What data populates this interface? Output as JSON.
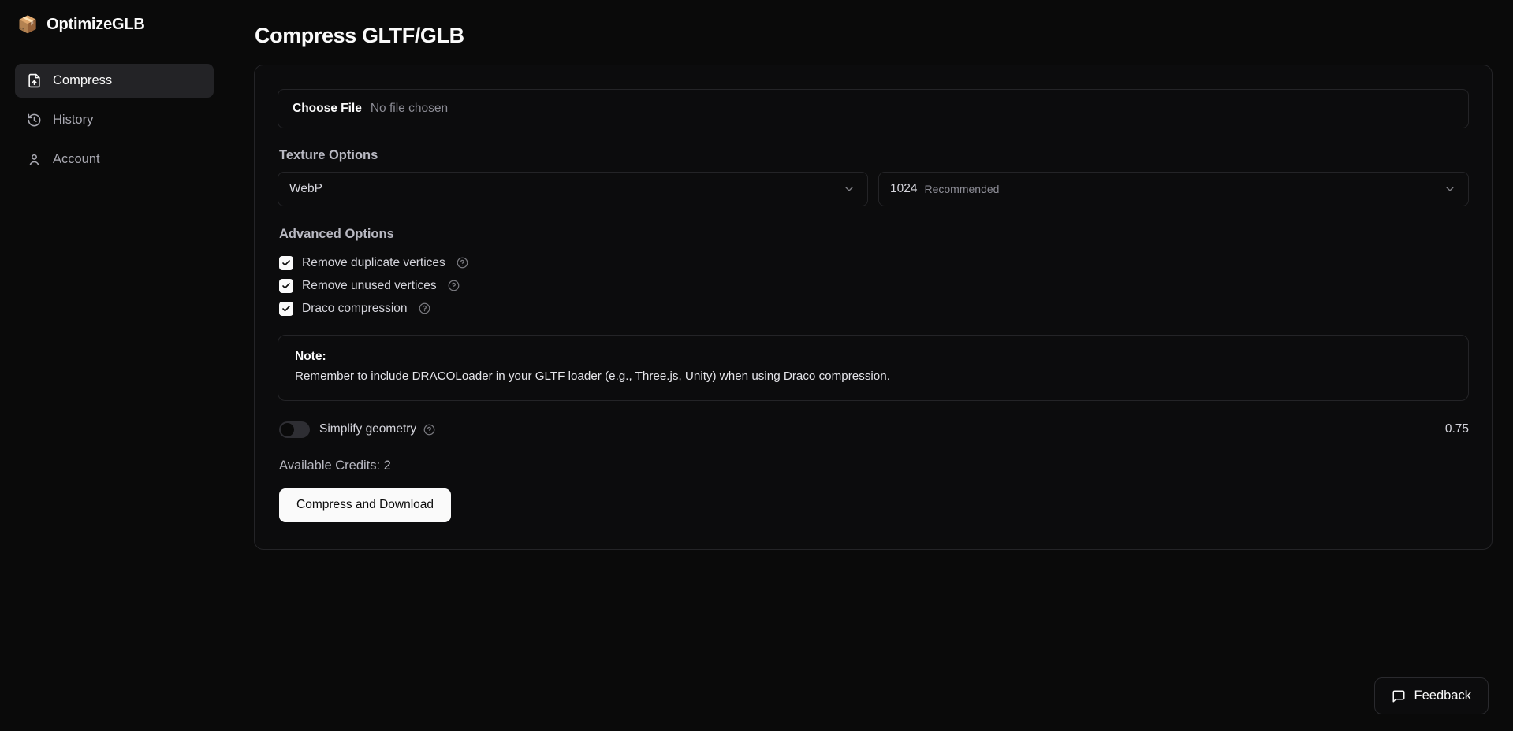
{
  "brand": {
    "icon": "package-icon",
    "glyph": "📦",
    "name": "OptimizeGLB"
  },
  "sidebar": {
    "items": [
      {
        "label": "Compress",
        "icon": "file-up-icon",
        "active": true
      },
      {
        "label": "History",
        "icon": "history-icon",
        "active": false
      },
      {
        "label": "Account",
        "icon": "user-icon",
        "active": false
      }
    ]
  },
  "page": {
    "title": "Compress GLTF/GLB"
  },
  "file_input": {
    "button_label": "Choose File",
    "status": "No file chosen"
  },
  "texture_options": {
    "heading": "Texture Options",
    "format_select": {
      "value": "WebP",
      "icon": "chevron-down-icon"
    },
    "resolution_select": {
      "value": "1024",
      "hint": "Recommended",
      "icon": "chevron-down-icon"
    }
  },
  "advanced_options": {
    "heading": "Advanced Options",
    "checkboxes": [
      {
        "label": "Remove duplicate vertices",
        "checked": true,
        "help_icon": "help-circle-icon"
      },
      {
        "label": "Remove unused vertices",
        "checked": true,
        "help_icon": "help-circle-icon"
      },
      {
        "label": "Draco compression",
        "checked": true,
        "help_icon": "help-circle-icon"
      }
    ]
  },
  "note": {
    "title": "Note:",
    "body": "Remember to include DRACOLoader in your GLTF loader (e.g., Three.js, Unity) when using Draco compression."
  },
  "simplify": {
    "label": "Simplify geometry",
    "enabled": false,
    "value": "0.75",
    "help_icon": "help-circle-icon"
  },
  "credits": {
    "text": "Available Credits: 2"
  },
  "actions": {
    "compress_label": "Compress and Download"
  },
  "feedback": {
    "label": "Feedback",
    "icon": "message-square-icon"
  },
  "colors": {
    "background": "#0a0a0a",
    "card_background": "#0c0c0d",
    "border": "#242427",
    "text_primary": "#fafafa",
    "text_muted": "#8d8d96",
    "accent": "#fafafa",
    "active_nav": "#232326"
  }
}
